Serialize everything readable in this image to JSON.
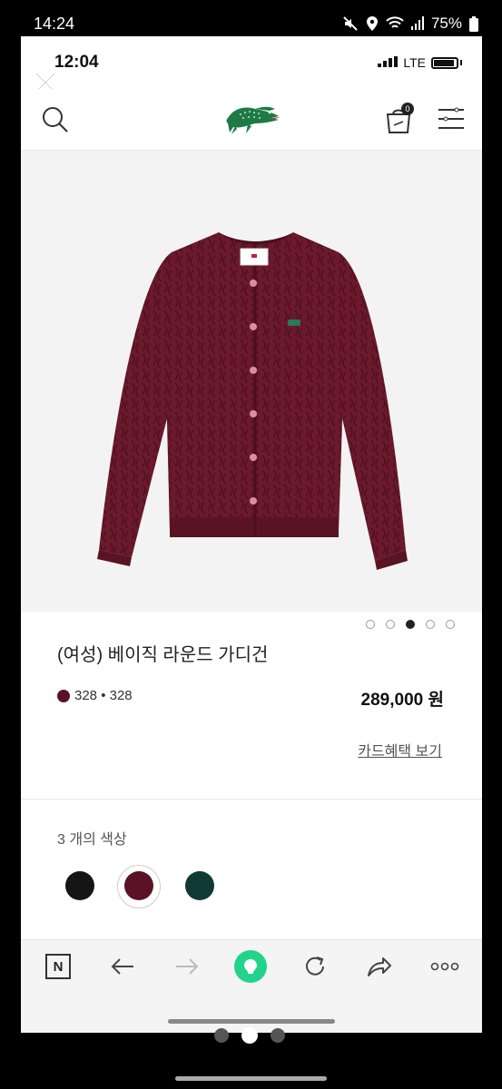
{
  "outer_status": {
    "time": "14:24",
    "battery": "75%",
    "icons": [
      "mute-icon",
      "location-icon",
      "wifi-icon",
      "signal-icon",
      "battery-icon"
    ]
  },
  "inner_status": {
    "time": "12:04",
    "network": "LTE"
  },
  "header": {
    "cart_count": "0",
    "icons": [
      "close-icon",
      "search-icon",
      "lacoste-logo",
      "shopping-bag-icon",
      "menu-icon"
    ]
  },
  "product": {
    "name": "(여성) 베이직 라운드 가디건",
    "variant": "328 • 328",
    "price": "289,000 원",
    "card_benefit_link": "카드혜택 보기",
    "image_dots": {
      "count": 5,
      "active_index": 2
    },
    "colors_label": "3 개의 색상",
    "colors": [
      {
        "name": "black",
        "hex": "#151515"
      },
      {
        "name": "burgundy",
        "hex": "#5b1226",
        "selected": true
      },
      {
        "name": "dark-green",
        "hex": "#0f3a35"
      }
    ],
    "selected_color_hex": "#5b1226"
  },
  "toolbar": {
    "n_label": "N",
    "icons": [
      "naver-n-icon",
      "back-arrow-icon",
      "forward-arrow-icon",
      "green-dot-icon",
      "reload-icon",
      "share-icon",
      "more-icon"
    ]
  },
  "pager": {
    "count": 3,
    "active_index": 1
  }
}
